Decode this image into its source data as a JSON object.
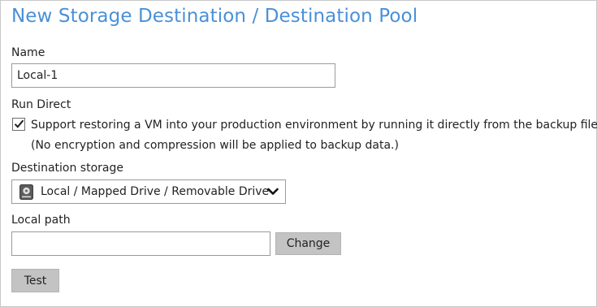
{
  "page": {
    "title": "New Storage Destination / Destination Pool"
  },
  "name_field": {
    "label": "Name",
    "value": "Local-1"
  },
  "run_direct": {
    "label": "Run Direct",
    "checked": true,
    "checkbox_label": "Support restoring a VM into your production environment by running it directly from the backup file",
    "note": "(No encryption and compression will be applied to backup data.)"
  },
  "destination_storage": {
    "label": "Destination storage",
    "selected": "Local / Mapped Drive / Removable Drive",
    "icon": "hard-drive-icon"
  },
  "local_path": {
    "label": "Local path",
    "value": "",
    "change_label": "Change"
  },
  "actions": {
    "test_label": "Test"
  },
  "colors": {
    "title": "#4a90d9",
    "button_bg": "#c3c3c3",
    "border": "#9a9a9a"
  }
}
